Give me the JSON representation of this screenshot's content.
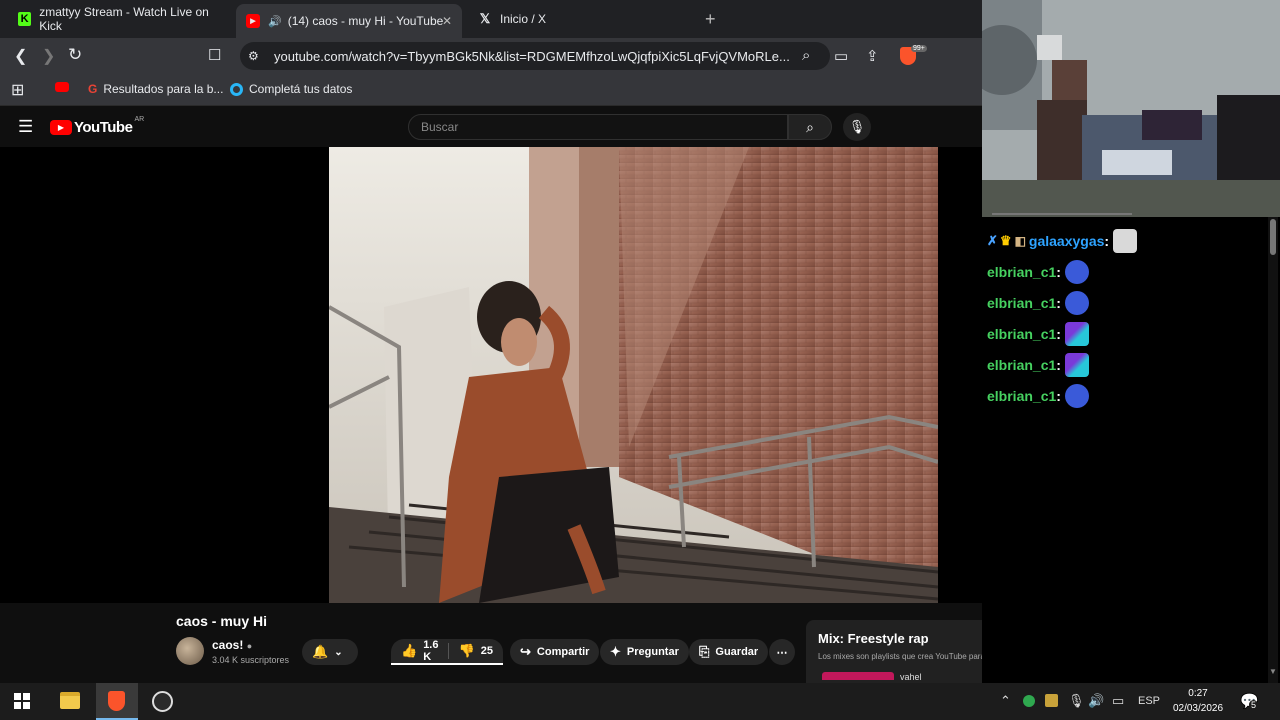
{
  "browser": {
    "tabs": [
      {
        "title": "zmattyy Stream - Watch Live on Kick",
        "active": false
      },
      {
        "title": "(14) caos - muy Hi - YouTube",
        "active": true
      },
      {
        "title": "Inicio / X",
        "active": false
      }
    ],
    "url": "youtube.com/watch?v=TbyymBGk5Nk&list=RDGMEMfhzoLwQjqfpiXic5LqFvjQVMoRLe...",
    "brave_badge": "99+",
    "bookmarks": [
      {
        "label": "Resultados para la b..."
      },
      {
        "label": "Completá tus datos"
      }
    ]
  },
  "youtube": {
    "logo": "YouTube",
    "region": "AR",
    "search_placeholder": "Buscar",
    "video": {
      "title": "caos - muy Hi",
      "channel": "caos!",
      "subscribers": "3.04 K suscriptores",
      "likes": "1.6 K",
      "dislikes": "25",
      "share_label": "Compartir",
      "ask_label": "Preguntar",
      "save_label": "Guardar"
    },
    "mix": {
      "title": "Mix: Freestyle rap",
      "subtitle": "Los mixes son playlists que crea YouTube para ti",
      "next_item": "vahel"
    }
  },
  "chat": {
    "messages": [
      {
        "user": "galaaxygas",
        "color": "#2ea3ff"
      },
      {
        "user": "elbrian_c1",
        "color": "#46d160"
      },
      {
        "user": "elbrian_c1",
        "color": "#46d160"
      },
      {
        "user": "elbrian_c1",
        "color": "#46d160"
      },
      {
        "user": "elbrian_c1",
        "color": "#46d160"
      },
      {
        "user": "elbrian_c1",
        "color": "#46d160"
      }
    ]
  },
  "taskbar": {
    "language": "ESP",
    "time": "0:27",
    "date": "02/03/2026",
    "notifications": "5"
  }
}
